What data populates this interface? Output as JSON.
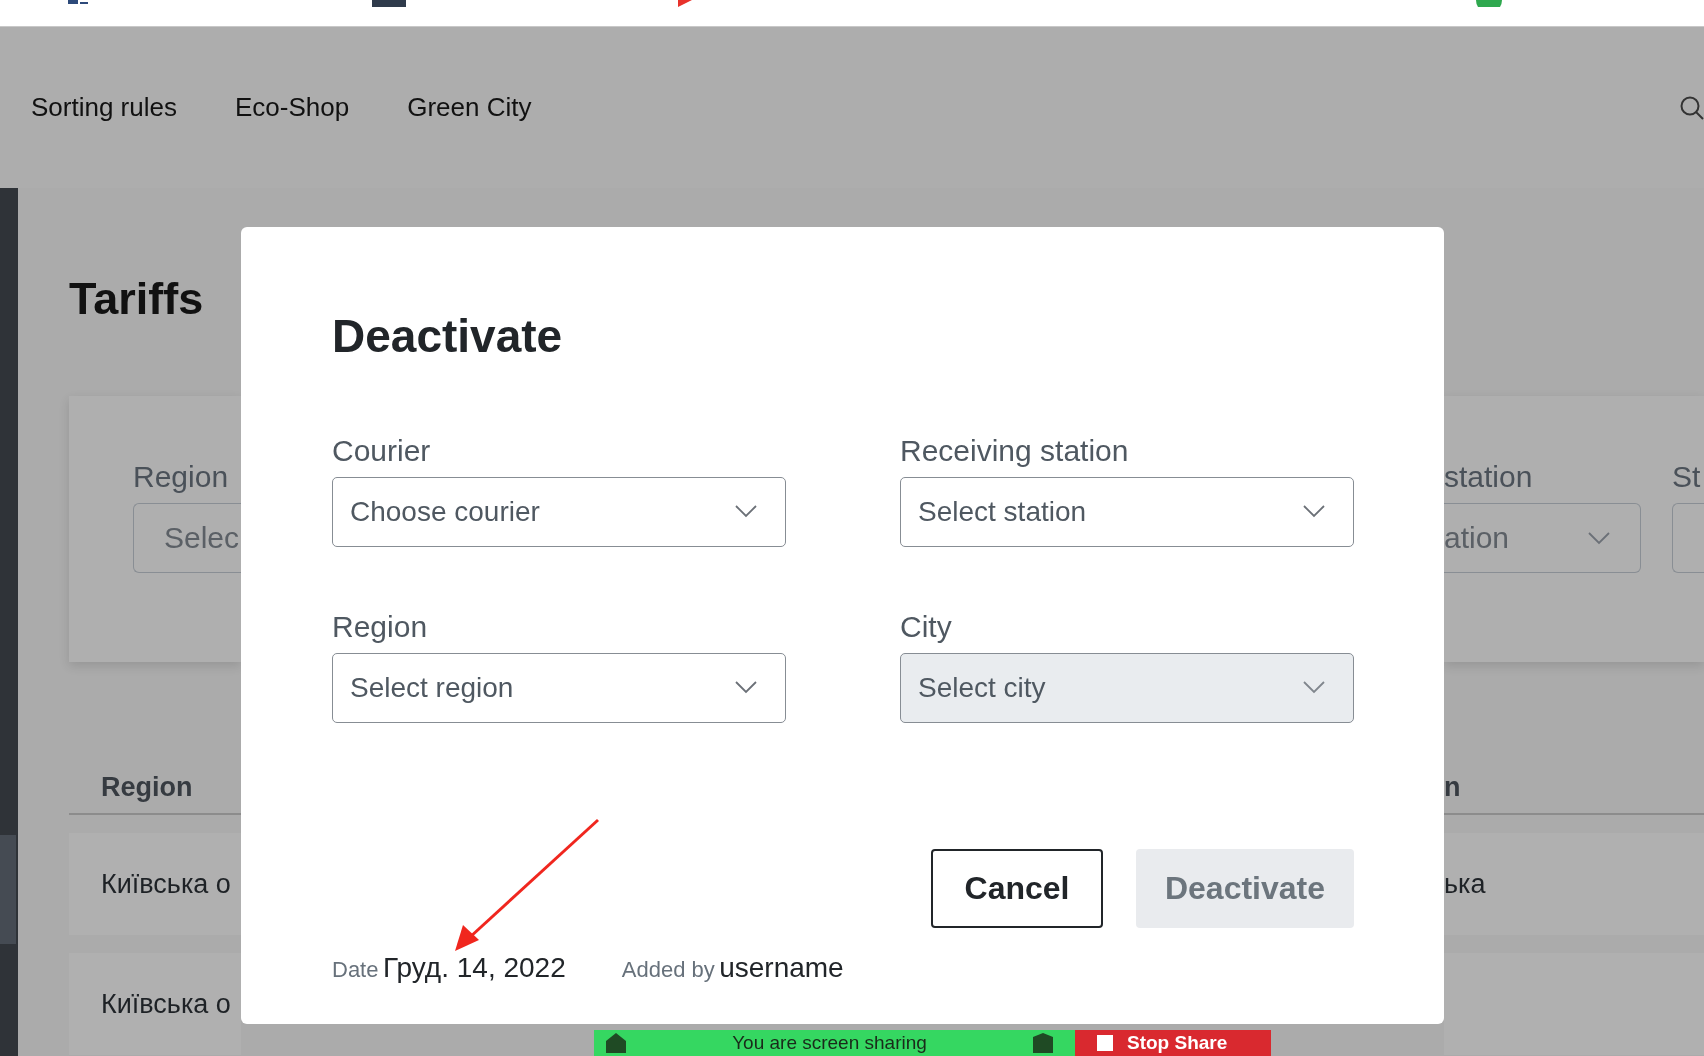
{
  "nav": {
    "items": [
      "Sorting rules",
      "Eco-Shop",
      "Green City"
    ]
  },
  "page": {
    "title": "Tariffs",
    "filters": [
      {
        "label": "Region",
        "placeholder": "Selec"
      },
      {
        "label": "station",
        "placeholder": "ation"
      },
      {
        "label": "St"
      }
    ],
    "table": {
      "columns": [
        "Region",
        "n"
      ],
      "rows": [
        [
          "Київська о",
          "ька"
        ],
        [
          "Київська о"
        ]
      ]
    }
  },
  "modal": {
    "title": "Deactivate",
    "fields": [
      {
        "label": "Courier",
        "placeholder": "Choose courier",
        "disabled": false
      },
      {
        "label": "Receiving station",
        "placeholder": "Select station",
        "disabled": false
      },
      {
        "label": "Region",
        "placeholder": "Select region",
        "disabled": false
      },
      {
        "label": "City",
        "placeholder": "Select city",
        "disabled": true
      }
    ],
    "buttons": [
      {
        "label": "Cancel",
        "kind": "secondary",
        "disabled": false
      },
      {
        "label": "Deactivate",
        "kind": "primary",
        "disabled": true
      }
    ],
    "meta": [
      {
        "label": "Date",
        "value": "Груд. 14, 2022"
      },
      {
        "label": "Added by",
        "value": "username"
      }
    ]
  },
  "sharing_bar": {
    "status": "You are screen sharing",
    "stop": "Stop Share"
  }
}
